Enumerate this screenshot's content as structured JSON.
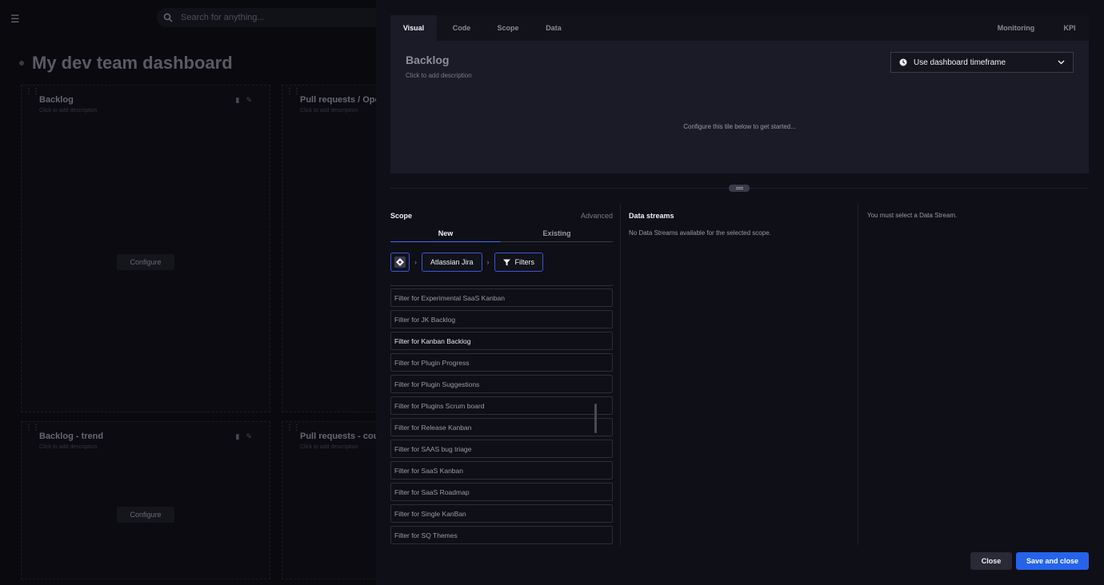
{
  "background": {
    "search_placeholder": "Search for anything...",
    "dashboard_title": "My dev team dashboard",
    "tiles": [
      {
        "title": "Backlog",
        "desc": "Click to add description",
        "configure": "Configure"
      },
      {
        "title": "Pull requests / Ope",
        "desc": "Click to add description"
      },
      {
        "title": "Backlog - trend",
        "desc": "Click to add description",
        "configure": "Configure"
      },
      {
        "title": "Pull requests - cour",
        "desc": "Click to add description"
      }
    ]
  },
  "tabs": {
    "left": [
      "Visual",
      "Code",
      "Scope",
      "Data"
    ],
    "right": [
      "Monitoring",
      "KPI"
    ],
    "active": "Visual"
  },
  "preview": {
    "title": "Backlog",
    "description": "Click to add description",
    "message": "Configure this tile below to get started...",
    "timeframe": "Use dashboard timeframe"
  },
  "scope": {
    "heading": "Scope",
    "advanced": "Advanced",
    "tab_new": "New",
    "tab_existing": "Existing",
    "crumbs": {
      "source": "Atlassian Jira",
      "filters": "Filters"
    },
    "items": [
      "Filter for Experimental SaaS Kanban",
      "Filter for JK Backlog",
      "Filter for Kanban Backlog",
      "Filter for Plugin Progress",
      "Filter for Plugin Suggestions",
      "Filter for Plugins Scrum board",
      "Filter for Release Kanban",
      "Filter for SAAS bug triage",
      "Filter for SaaS Kanban",
      "Filter for SaaS Roadmap",
      "Filter for Single KanBan",
      "Filter for SQ Themes"
    ],
    "highlighted_index": 2
  },
  "data_streams": {
    "heading": "Data streams",
    "empty_message": "No Data Streams available for the selected scope."
  },
  "selection_message": "You must select a Data Stream.",
  "footer": {
    "close": "Close",
    "save": "Save and close"
  },
  "colors": {
    "accent": "#2563eb",
    "crumb_border": "#3a55d0"
  }
}
